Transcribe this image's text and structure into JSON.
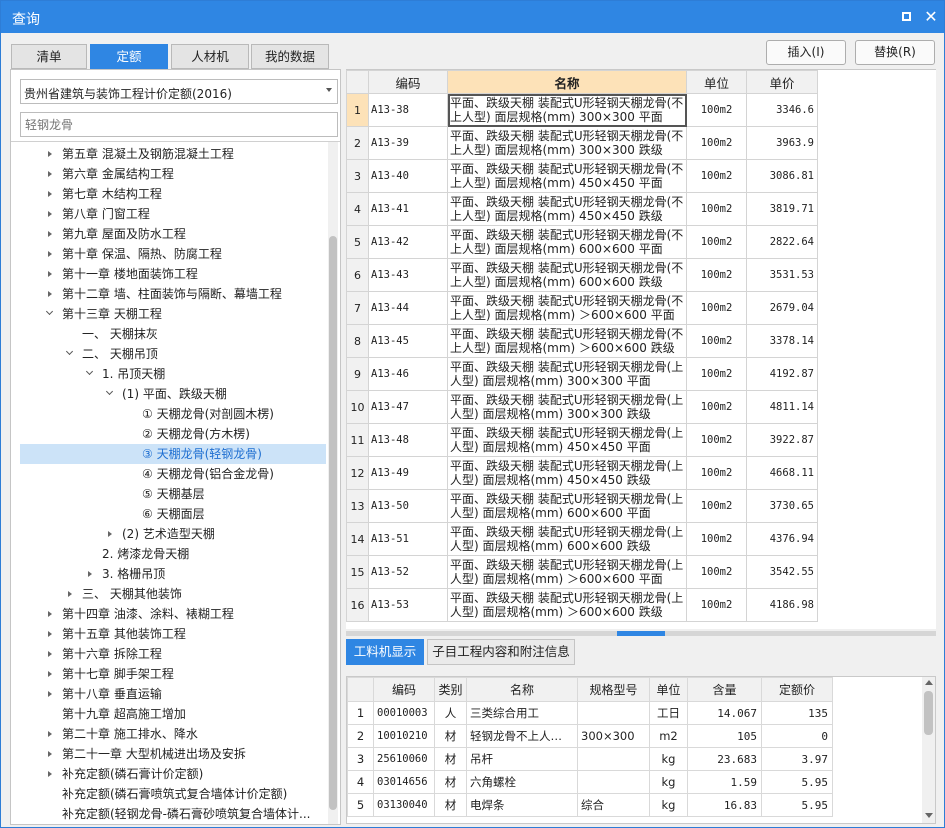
{
  "window": {
    "title": "查询",
    "maximize_icon": "maximize-icon",
    "close_icon": "close-icon"
  },
  "tabs": [
    "清单",
    "定额",
    "人材机",
    "我的数据"
  ],
  "active_tab": "定额",
  "actions": {
    "insert": "插入(I)",
    "replace": "替换(R)"
  },
  "quota_library": {
    "selected": "贵州省建筑与装饰工程计价定额(2016)"
  },
  "search": {
    "value": "",
    "placeholder": "轻钢龙骨"
  },
  "tree": [
    {
      "label": "第五章 混凝土及钢筋混凝土工程",
      "level": 0,
      "state": "collapsed"
    },
    {
      "label": "第六章 金属结构工程",
      "level": 0,
      "state": "collapsed"
    },
    {
      "label": "第七章 木结构工程",
      "level": 0,
      "state": "collapsed"
    },
    {
      "label": "第八章 门窗工程",
      "level": 0,
      "state": "collapsed"
    },
    {
      "label": "第九章 屋面及防水工程",
      "level": 0,
      "state": "collapsed"
    },
    {
      "label": "第十章 保温、隔热、防腐工程",
      "level": 0,
      "state": "collapsed"
    },
    {
      "label": "第十一章 楼地面装饰工程",
      "level": 0,
      "state": "collapsed"
    },
    {
      "label": "第十二章 墙、柱面装饰与隔断、幕墙工程",
      "level": 0,
      "state": "collapsed"
    },
    {
      "label": "第十三章 天棚工程",
      "level": 0,
      "state": "expanded"
    },
    {
      "label": "一、 天棚抹灰",
      "level": 1,
      "state": "leaf"
    },
    {
      "label": "二、 天棚吊顶",
      "level": 1,
      "state": "expanded"
    },
    {
      "label": "1. 吊顶天棚",
      "level": 2,
      "state": "expanded"
    },
    {
      "label": "(1) 平面、跌级天棚",
      "level": 3,
      "state": "expanded"
    },
    {
      "label": "① 天棚龙骨(对剖圆木楞)",
      "level": 4,
      "state": "leaf"
    },
    {
      "label": "② 天棚龙骨(方木楞)",
      "level": 4,
      "state": "leaf"
    },
    {
      "label": "③ 天棚龙骨(轻钢龙骨)",
      "level": 4,
      "state": "leaf",
      "selected": true
    },
    {
      "label": "④ 天棚龙骨(铝合金龙骨)",
      "level": 4,
      "state": "leaf"
    },
    {
      "label": "⑤ 天棚基层",
      "level": 4,
      "state": "leaf"
    },
    {
      "label": "⑥ 天棚面层",
      "level": 4,
      "state": "leaf"
    },
    {
      "label": "(2) 艺术造型天棚",
      "level": 3,
      "state": "collapsed"
    },
    {
      "label": "2. 烤漆龙骨天棚",
      "level": 2,
      "state": "leaf"
    },
    {
      "label": "3. 格栅吊顶",
      "level": 2,
      "state": "collapsed"
    },
    {
      "label": "三、 天棚其他装饰",
      "level": 1,
      "state": "collapsed"
    },
    {
      "label": "第十四章 油漆、涂料、裱糊工程",
      "level": 0,
      "state": "collapsed"
    },
    {
      "label": "第十五章 其他装饰工程",
      "level": 0,
      "state": "collapsed"
    },
    {
      "label": "第十六章 拆除工程",
      "level": 0,
      "state": "collapsed"
    },
    {
      "label": "第十七章 脚手架工程",
      "level": 0,
      "state": "collapsed"
    },
    {
      "label": "第十八章 垂直运输",
      "level": 0,
      "state": "collapsed"
    },
    {
      "label": "第十九章 超高施工增加",
      "level": 0,
      "state": "leaf"
    },
    {
      "label": "第二十章 施工排水、降水",
      "level": 0,
      "state": "collapsed"
    },
    {
      "label": "第二十一章 大型机械进出场及安拆",
      "level": 0,
      "state": "collapsed"
    },
    {
      "label": "补充定额(磷石膏计价定额)",
      "level": 0,
      "state": "collapsed"
    },
    {
      "label": "补充定额(磷石膏喷筑式复合墙体计价定额)",
      "level": 0,
      "state": "leaf"
    },
    {
      "label": "补充定额(轻钢龙骨-磷石膏砂喷筑复合墙体计...",
      "level": 0,
      "state": "leaf"
    }
  ],
  "main_table": {
    "columns": [
      "编码",
      "名称",
      "单位",
      "单价"
    ],
    "rows": [
      {
        "no": "1",
        "code": "A13-38",
        "name": "平面、跌级天棚 装配式U形轻钢天棚龙骨(不上人型) 面层规格(mm) 300×300 平面",
        "unit": "100m2",
        "price": "3346.6"
      },
      {
        "no": "2",
        "code": "A13-39",
        "name": "平面、跌级天棚 装配式U形轻钢天棚龙骨(不上人型) 面层规格(mm) 300×300 跌级",
        "unit": "100m2",
        "price": "3963.9"
      },
      {
        "no": "3",
        "code": "A13-40",
        "name": "平面、跌级天棚 装配式U形轻钢天棚龙骨(不上人型) 面层规格(mm) 450×450 平面",
        "unit": "100m2",
        "price": "3086.81"
      },
      {
        "no": "4",
        "code": "A13-41",
        "name": "平面、跌级天棚 装配式U形轻钢天棚龙骨(不上人型) 面层规格(mm) 450×450 跌级",
        "unit": "100m2",
        "price": "3819.71"
      },
      {
        "no": "5",
        "code": "A13-42",
        "name": "平面、跌级天棚 装配式U形轻钢天棚龙骨(不上人型) 面层规格(mm) 600×600 平面",
        "unit": "100m2",
        "price": "2822.64"
      },
      {
        "no": "6",
        "code": "A13-43",
        "name": "平面、跌级天棚 装配式U形轻钢天棚龙骨(不上人型) 面层规格(mm) 600×600 跌级",
        "unit": "100m2",
        "price": "3531.53"
      },
      {
        "no": "7",
        "code": "A13-44",
        "name": "平面、跌级天棚 装配式U形轻钢天棚龙骨(不上人型) 面层规格(mm) ＞600×600 平面",
        "unit": "100m2",
        "price": "2679.04"
      },
      {
        "no": "8",
        "code": "A13-45",
        "name": "平面、跌级天棚 装配式U形轻钢天棚龙骨(不上人型) 面层规格(mm) ＞600×600 跌级",
        "unit": "100m2",
        "price": "3378.14"
      },
      {
        "no": "9",
        "code": "A13-46",
        "name": "平面、跌级天棚 装配式U形轻钢天棚龙骨(上人型) 面层规格(mm) 300×300 平面",
        "unit": "100m2",
        "price": "4192.87"
      },
      {
        "no": "10",
        "code": "A13-47",
        "name": "平面、跌级天棚 装配式U形轻钢天棚龙骨(上人型) 面层规格(mm) 300×300 跌级",
        "unit": "100m2",
        "price": "4811.14"
      },
      {
        "no": "11",
        "code": "A13-48",
        "name": "平面、跌级天棚 装配式U形轻钢天棚龙骨(上人型) 面层规格(mm) 450×450 平面",
        "unit": "100m2",
        "price": "3922.87"
      },
      {
        "no": "12",
        "code": "A13-49",
        "name": "平面、跌级天棚 装配式U形轻钢天棚龙骨(上人型) 面层规格(mm) 450×450 跌级",
        "unit": "100m2",
        "price": "4668.11"
      },
      {
        "no": "13",
        "code": "A13-50",
        "name": "平面、跌级天棚 装配式U形轻钢天棚龙骨(上人型) 面层规格(mm) 600×600 平面",
        "unit": "100m2",
        "price": "3730.65"
      },
      {
        "no": "14",
        "code": "A13-51",
        "name": "平面、跌级天棚 装配式U形轻钢天棚龙骨(上人型) 面层规格(mm) 600×600 跌级",
        "unit": "100m2",
        "price": "4376.94"
      },
      {
        "no": "15",
        "code": "A13-52",
        "name": "平面、跌级天棚 装配式U形轻钢天棚龙骨(上人型) 面层规格(mm) ＞600×600 平面",
        "unit": "100m2",
        "price": "3542.55"
      },
      {
        "no": "16",
        "code": "A13-53",
        "name": "平面、跌级天棚 装配式U形轻钢天棚龙骨(上人型) 面层规格(mm) ＞600×600 跌级",
        "unit": "100m2",
        "price": "4186.98"
      }
    ]
  },
  "bottom_tabs": [
    "工料机显示",
    "子目工程内容和附注信息"
  ],
  "bottom_active_tab": "工料机显示",
  "resource_table": {
    "columns": [
      "编码",
      "类别",
      "名称",
      "规格型号",
      "单位",
      "含量",
      "定额价"
    ],
    "rows": [
      {
        "no": "1",
        "code": "00010003",
        "type": "人",
        "name": "三类综合用工",
        "spec": "",
        "unit": "工日",
        "qty": "14.067",
        "price": "135"
      },
      {
        "no": "2",
        "code": "10010210",
        "type": "材",
        "name": "轻钢龙骨不上人…",
        "spec": "300×300",
        "unit": "m2",
        "qty": "105",
        "price": "0"
      },
      {
        "no": "3",
        "code": "25610060",
        "type": "材",
        "name": "吊杆",
        "spec": "",
        "unit": "kg",
        "qty": "23.683",
        "price": "3.97"
      },
      {
        "no": "4",
        "code": "03014656",
        "type": "材",
        "name": "六角螺栓",
        "spec": "",
        "unit": "kg",
        "qty": "1.59",
        "price": "5.95"
      },
      {
        "no": "5",
        "code": "03130040",
        "type": "材",
        "name": "电焊条",
        "spec": "综合",
        "unit": "kg",
        "qty": "16.83",
        "price": "5.95"
      }
    ]
  },
  "colors": {
    "accent": "#2f86e3",
    "header_highlight": "#fde2b8",
    "tree_selected": "#cce3f8"
  }
}
